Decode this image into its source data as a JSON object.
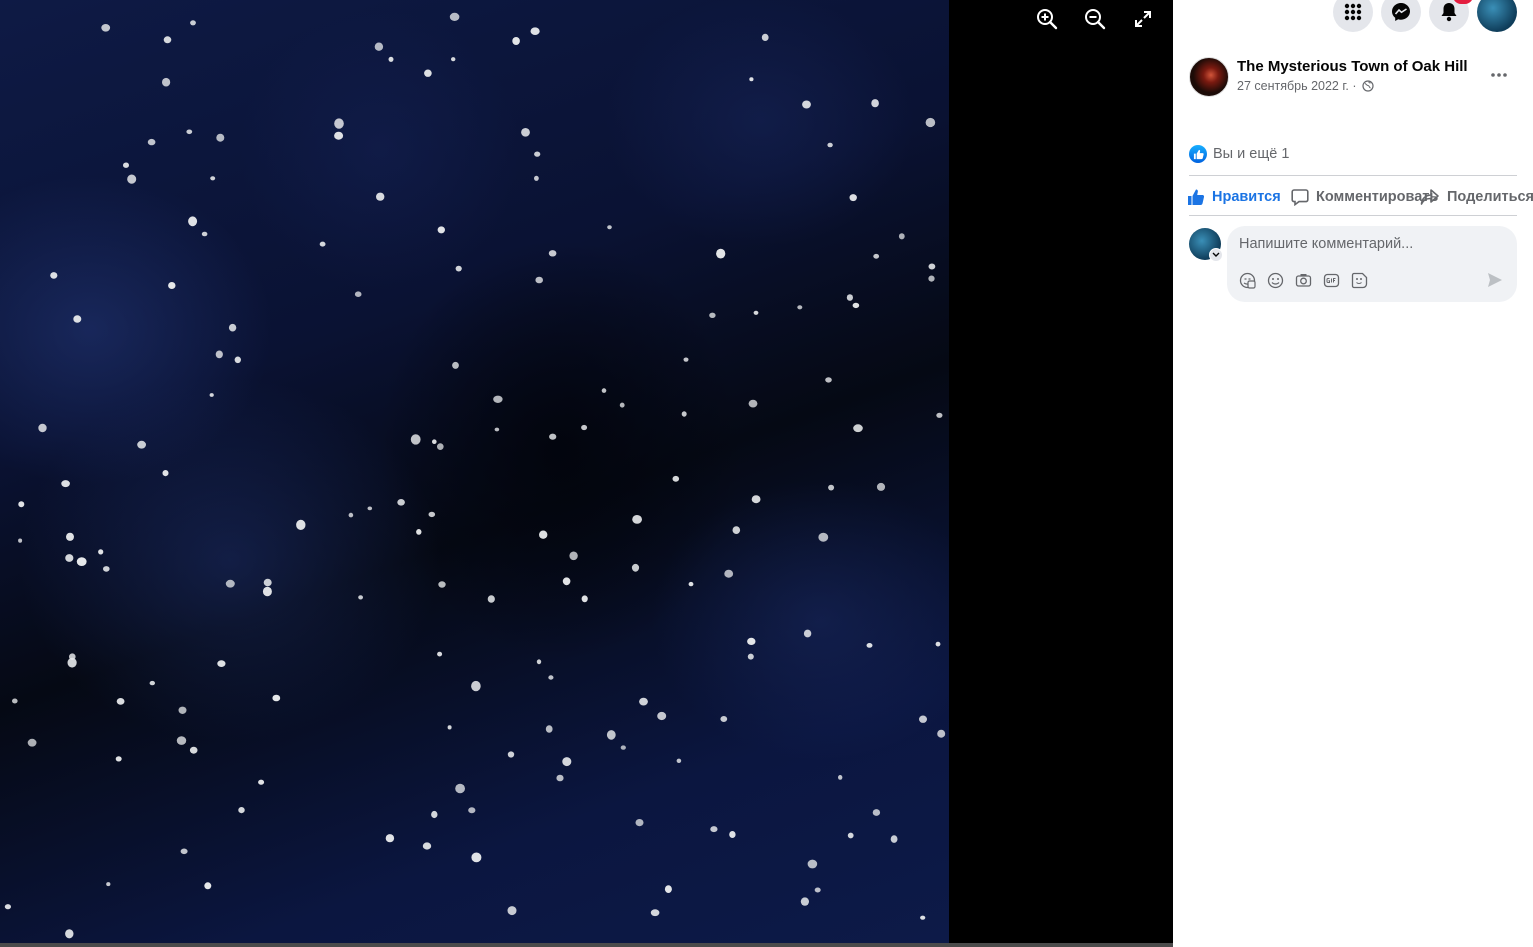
{
  "viewer": {
    "controls": [
      "zoom-in",
      "zoom-out",
      "fullscreen"
    ]
  },
  "topbar": {
    "icons": [
      "menu-grid-icon",
      "messenger-icon",
      "bell-icon"
    ],
    "notification_count": ""
  },
  "post": {
    "page_name": "The Mysterious Town of Oak Hill",
    "date": "27 сентябрь 2022 г. ·",
    "audience_icon": "globe-icon",
    "reactions_text": "Вы и ещё 1",
    "actions": {
      "like": "Нравится",
      "comment": "Комментировать",
      "share": "Поделиться"
    },
    "comment": {
      "placeholder": "Напишите комментарий..."
    }
  },
  "colors": {
    "accent": "#1b74e4",
    "secondary_text": "#65676b",
    "badge": "#e41e3f"
  }
}
